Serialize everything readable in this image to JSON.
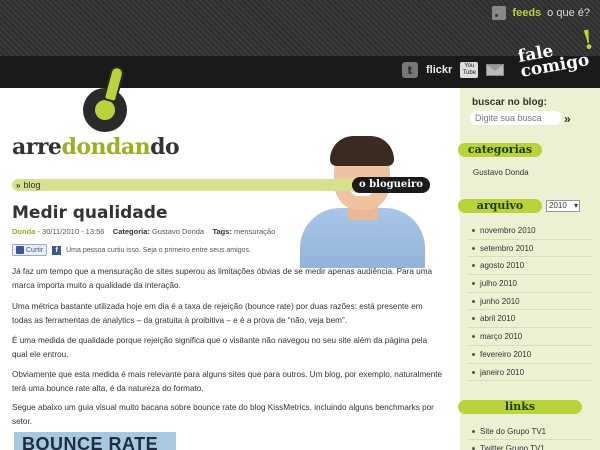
{
  "topbar": {
    "feeds_label": "feeds",
    "feeds_more": "o que é?",
    "social": {
      "flickr": "flickr",
      "youtube": "You Tube"
    },
    "contact": {
      "line1": "fale",
      "line2": "comigo",
      "excl": "!"
    }
  },
  "header": {
    "logo": {
      "part1": "arre",
      "part2": "dondan",
      "part3": "do"
    },
    "breadcrumb": "blog",
    "breadcrumb_sep": "»",
    "badge": "o blogueiro"
  },
  "post": {
    "title": "Medir qualidade",
    "author": "Donda",
    "date": "- 30/11/2010 - 13:56",
    "category_label": "Categoria:",
    "category": "Gustavo Donda",
    "tags_label": "Tags:",
    "tags": "mensuração",
    "like_button": "Curtir",
    "like_text": "Uma pessoa curtiu isso. Seja o primeiro entre seus amigos.",
    "paragraphs": [
      "Já faz um tempo que a mensuração de sites superou as limitações óbvias de se medir apenas audiência. Para uma marca importa muito a qualidade da interação.",
      "Uma métrica bastante utilizada hoje em dia é a taxa de rejeição (bounce rate) por duas razões: está presente em todas as ferramentas de analytics – da gratuita à proibitiva – e é a prova de “não, veja bem”.",
      "É uma medida de qualidade porque rejeição significa que o visitante não navegou no seu site além da página pela qual ele entrou.",
      "Obviamente que esta medida é mais relevante para alguns sites que para outros. Um blog, por exemplo, naturalmente terá uma bounce rate alta, é da natureza do formato.",
      "Segue abaixo um guia visual muito bacana sobre bounce rate do blog KissMetrics, incluindo alguns benchmarks por setor."
    ],
    "image_caption": "BOUNCE RATE"
  },
  "sidebar": {
    "search_title": "buscar no blog:",
    "search_placeholder": "Digite sua busca",
    "search_go": "»",
    "categories_title": "categorias",
    "categories": [
      "Gustavo Donda"
    ],
    "archive_title": "arquivo",
    "archive_year": "2010",
    "archive": [
      "novembro 2010",
      "setembro 2010",
      "agosto 2010",
      "julho 2010",
      "junho 2010",
      "abril 2010",
      "março 2010",
      "fevereiro 2010",
      "janeiro 2010"
    ],
    "links_title": "links",
    "links": [
      "Site do Grupo TV1",
      "Twitter Grupo TV1"
    ]
  },
  "colors": {
    "accent": "#b8d43a",
    "dark": "#1a1a1a",
    "sidebar_bg": "#eef0d4"
  }
}
